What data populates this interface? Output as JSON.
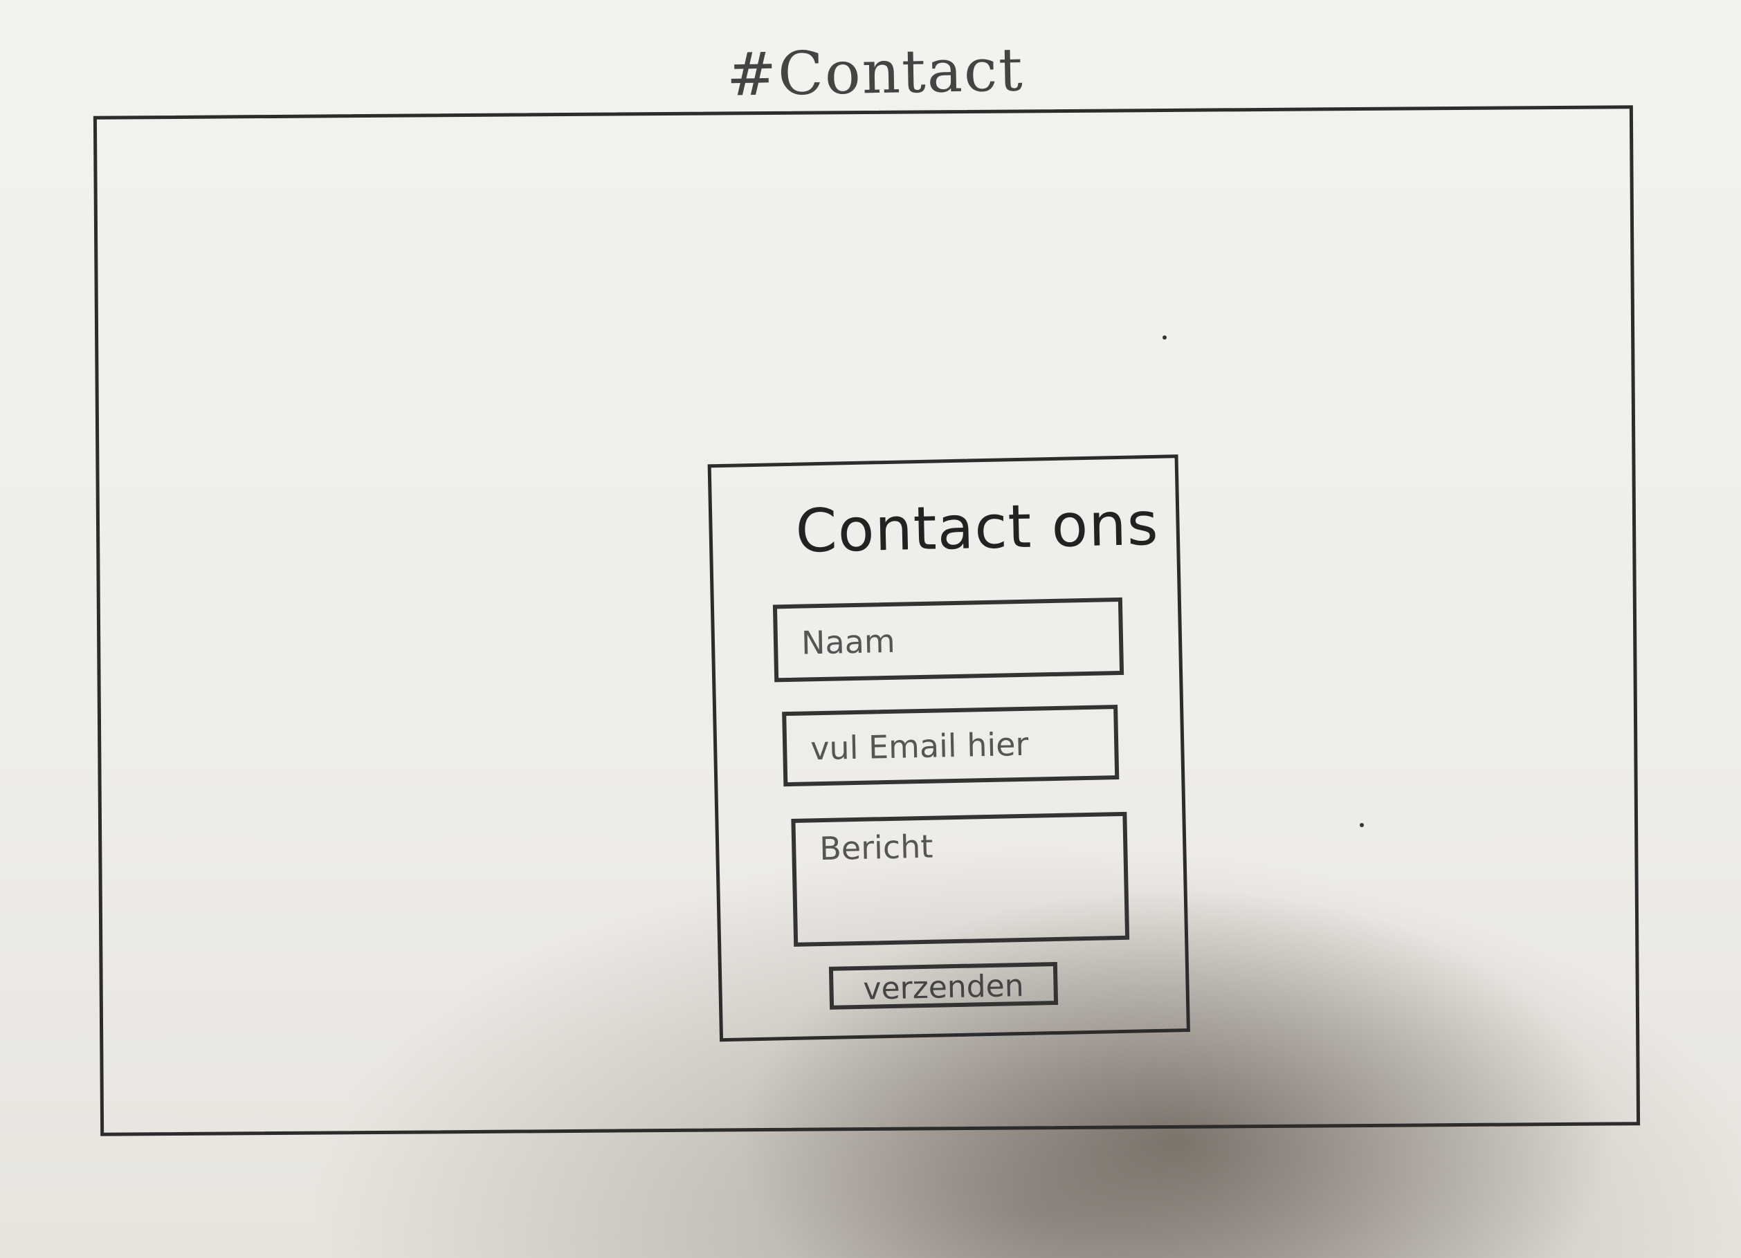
{
  "page": {
    "section_title": "#Contact"
  },
  "contact_form": {
    "title": "Contact ons",
    "name_placeholder": "Naam",
    "email_placeholder": "vul Email hier",
    "message_placeholder": "Bericht",
    "submit_label": "verzenden"
  }
}
